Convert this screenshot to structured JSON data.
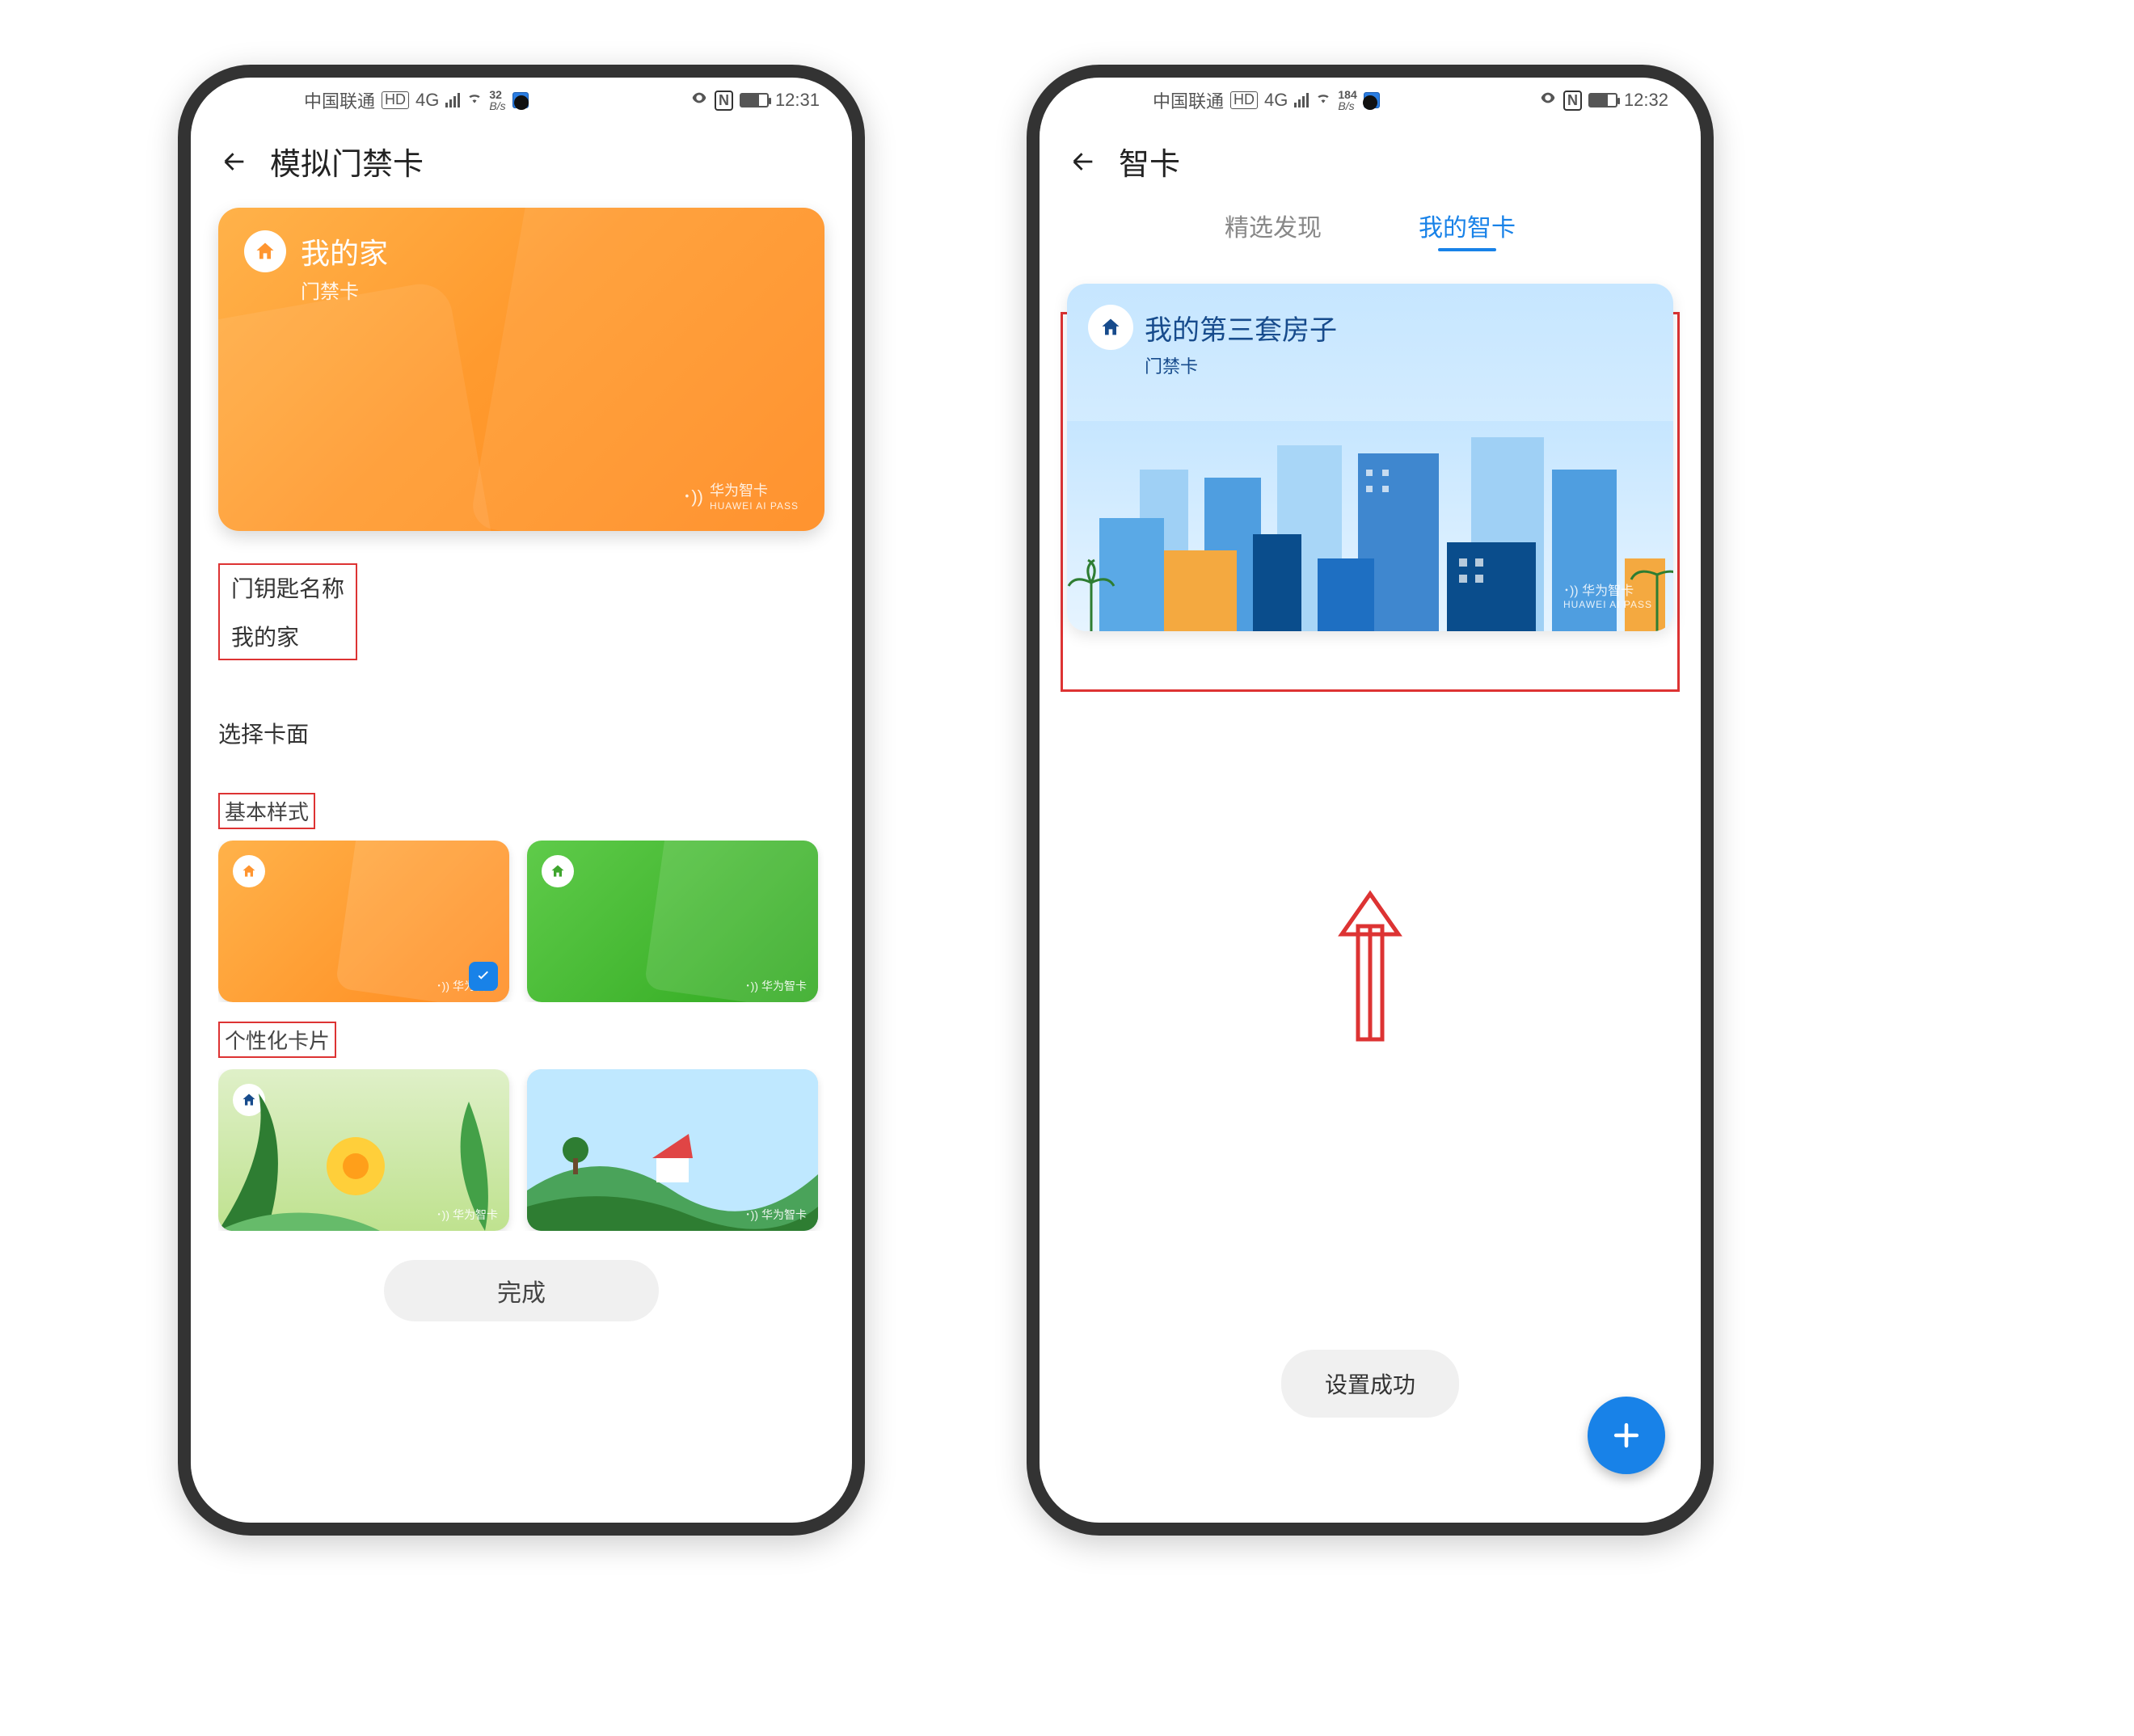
{
  "status": {
    "carrier": "中国联通",
    "hd": "HD",
    "net": "4G",
    "speed1": {
      "kbps": "32",
      "unit": "B/s"
    },
    "speed2": {
      "kbps": "184",
      "unit": "B/s"
    },
    "nfc": "N",
    "time1": "12:31",
    "time2": "12:32"
  },
  "screen1": {
    "title": "模拟门禁卡",
    "card": {
      "title": "我的家",
      "subtitle": "门禁卡",
      "brand_cn": "华为智卡",
      "brand_en": "HUAWEI AI PASS"
    },
    "name_field": {
      "label": "门钥匙名称",
      "value": "我的家"
    },
    "choose_label": "选择卡面",
    "basic_label": "基本样式",
    "personal_label": "个性化卡片",
    "mini_brand": "华为智卡",
    "done": "完成"
  },
  "screen2": {
    "title": "智卡",
    "tab1": "精选发现",
    "tab2": "我的智卡",
    "card": {
      "title": "我的第三套房子",
      "subtitle": "门禁卡",
      "brand_cn": "华为智卡",
      "brand_en": "HUAWEI AI PASS"
    },
    "toast": "设置成功"
  }
}
